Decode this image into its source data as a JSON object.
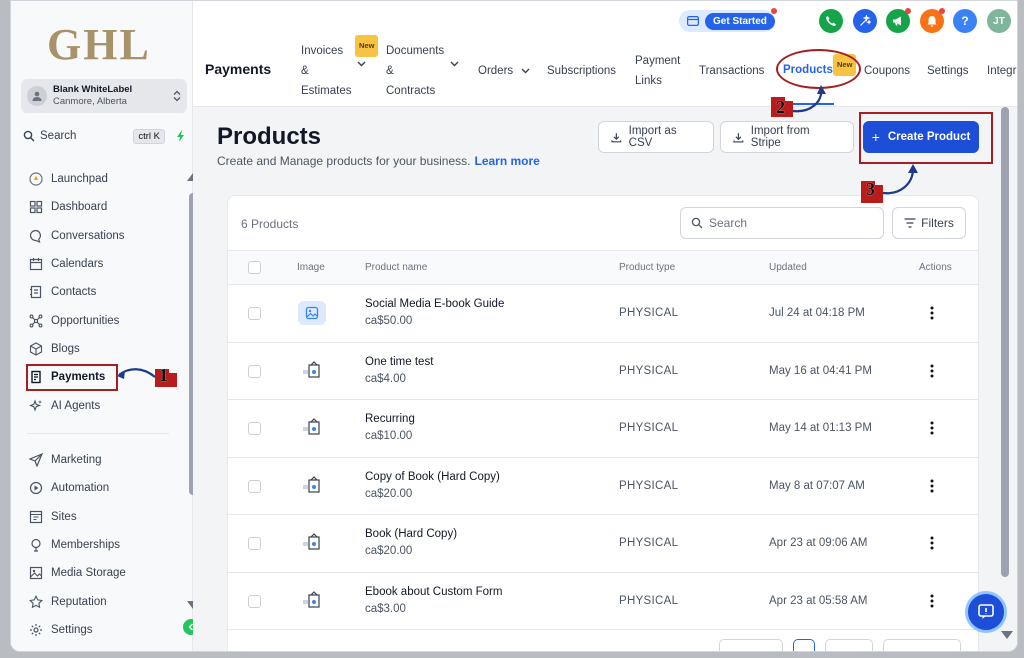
{
  "app": {
    "logo": "GHL",
    "account": {
      "name": "Blank WhiteLabel",
      "location": "Canmore, Alberta"
    },
    "search": {
      "label": "Search",
      "shortcut": "ctrl K"
    }
  },
  "sidebar": {
    "items": [
      {
        "label": "Launchpad",
        "icon": "rocket-icon"
      },
      {
        "label": "Dashboard",
        "icon": "grid-icon"
      },
      {
        "label": "Conversations",
        "icon": "chat-icon"
      },
      {
        "label": "Calendars",
        "icon": "calendar-icon"
      },
      {
        "label": "Contacts",
        "icon": "contacts-icon"
      },
      {
        "label": "Opportunities",
        "icon": "network-icon"
      },
      {
        "label": "Blogs",
        "icon": "box-icon"
      },
      {
        "label": "Payments",
        "icon": "receipt-icon",
        "active": true
      },
      {
        "label": "AI Agents",
        "icon": "sparkle-icon"
      }
    ],
    "items2": [
      {
        "label": "Marketing",
        "icon": "send-icon"
      },
      {
        "label": "Automation",
        "icon": "automation-icon"
      },
      {
        "label": "Sites",
        "icon": "sites-icon"
      },
      {
        "label": "Memberships",
        "icon": "membership-icon"
      },
      {
        "label": "Media Storage",
        "icon": "image-icon"
      },
      {
        "label": "Reputation",
        "icon": "star-icon"
      },
      {
        "label": "Settings",
        "icon": "gear-icon"
      }
    ]
  },
  "header": {
    "get_started": "Get Started",
    "user_initials": "JT",
    "help_label": "?",
    "section_title": "Payments",
    "badge_new": "New",
    "tabs": {
      "invoices": [
        "Invoices",
        "&",
        "Estimates"
      ],
      "documents": [
        "Documents",
        "&",
        "Contracts"
      ],
      "orders": "Orders",
      "subscriptions": "Subscriptions",
      "payment_links": [
        "Payment",
        "Links"
      ],
      "transactions": "Transactions",
      "products": "Products",
      "coupons": "Coupons",
      "settings": "Settings",
      "integrations": "Integra"
    }
  },
  "annotations": {
    "step1": "1",
    "step2": "2",
    "step3": "3"
  },
  "main": {
    "title": "Products",
    "subtitle": "Create and Manage products for your business.",
    "learn_more": "Learn more",
    "import_csv": "Import as CSV",
    "import_stripe": "Import from Stripe",
    "create_product": "Create Product"
  },
  "table": {
    "count_label": "6 Products",
    "search_placeholder": "Search",
    "filters_label": "Filters",
    "columns": {
      "image": "Image",
      "name": "Product name",
      "type": "Product type",
      "updated": "Updated",
      "actions": "Actions"
    },
    "rows": [
      {
        "name": "Social Media E-book Guide",
        "price": "ca$50.00",
        "type": "PHYSICAL",
        "updated": "Jul 24 at 04:18 PM",
        "image": "image-placeholder-icon"
      },
      {
        "name": "One time test",
        "price": "ca$4.00",
        "type": "PHYSICAL",
        "updated": "May 16 at 04:41 PM",
        "image": "product-thumb-icon"
      },
      {
        "name": "Recurring",
        "price": "ca$10.00",
        "type": "PHYSICAL",
        "updated": "May 14 at 01:13 PM",
        "image": "product-thumb-icon"
      },
      {
        "name": "Copy of Book (Hard Copy)",
        "price": "ca$20.00",
        "type": "PHYSICAL",
        "updated": "May 8 at 07:07 AM",
        "image": "product-thumb-icon"
      },
      {
        "name": "Book (Hard Copy)",
        "price": "ca$20.00",
        "type": "PHYSICAL",
        "updated": "Apr 23 at 09:06 AM",
        "image": "product-thumb-icon"
      },
      {
        "name": "Ebook about Custom Form",
        "price": "ca$3.00",
        "type": "PHYSICAL",
        "updated": "Apr 23 at 05:58 AM",
        "image": "product-thumb-icon"
      }
    ]
  },
  "colors": {
    "accent": "#2563eb",
    "annotation": "#a61e22",
    "logo": "#a8926a"
  }
}
